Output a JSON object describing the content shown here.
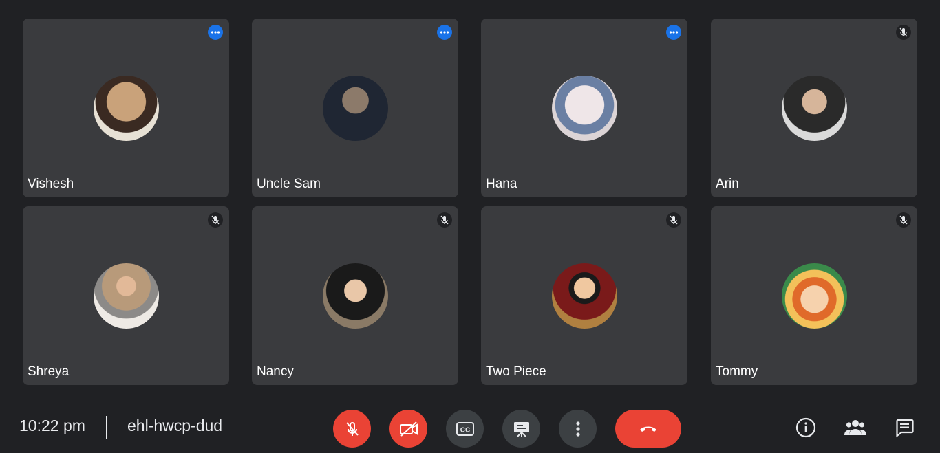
{
  "participants": [
    {
      "name": "Vishesh",
      "status": "more",
      "avatar_colors": [
        "#c9a27a",
        "#3a2a22"
      ]
    },
    {
      "name": "Uncle Sam",
      "status": "more",
      "avatar_colors": [
        "#8c7a6a",
        "#1f2633"
      ]
    },
    {
      "name": "Hana",
      "status": "more",
      "avatar_colors": [
        "#e8dde0",
        "#6a7fa3"
      ]
    },
    {
      "name": "Arin",
      "status": "muted",
      "avatar_colors": [
        "#d9d9d9",
        "#2a2a2a"
      ]
    },
    {
      "name": "Shreya",
      "status": "muted",
      "avatar_colors": [
        "#e9e2d8",
        "#b89a7a"
      ]
    },
    {
      "name": "Nancy",
      "status": "muted",
      "avatar_colors": [
        "#8a7a66",
        "#1a1a1a"
      ]
    },
    {
      "name": "Two Piece",
      "status": "muted",
      "avatar_colors": [
        "#b08040",
        "#7a1a1a"
      ]
    },
    {
      "name": "Tommy",
      "status": "muted",
      "avatar_colors": [
        "#f3c15a",
        "#3a8a4a"
      ]
    }
  ],
  "meeting": {
    "time": "10:22 pm",
    "code": "ehl-hwcp-dud"
  },
  "controls": {
    "mic": "mic-off-icon",
    "camera": "camera-off-icon",
    "captions": "captions-icon",
    "present": "present-icon",
    "more": "more-vert-icon",
    "hangup": "hang-up-icon"
  },
  "side_actions": [
    "info-icon",
    "people-icon",
    "chat-icon"
  ],
  "colors": {
    "red": "#ea4335",
    "blue": "#1a73e8",
    "tile": "#3a3b3e",
    "bg": "#202124"
  }
}
